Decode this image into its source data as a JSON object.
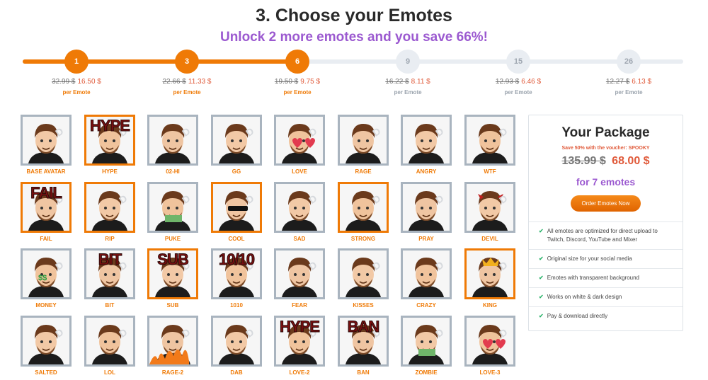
{
  "header": {
    "title": "3. Choose your Emotes",
    "subtitle": "Unlock 2 more emotes and you save 66%!"
  },
  "steps": [
    {
      "count": "1",
      "old_price": "32.99 $",
      "new_price": "16.50 $",
      "per": "per Emote",
      "active": true
    },
    {
      "count": "3",
      "old_price": "22.66 $",
      "new_price": "11.33 $",
      "per": "per Emote",
      "active": true
    },
    {
      "count": "6",
      "old_price": "19.50 $",
      "new_price": "9.75 $",
      "per": "per Emote",
      "active": true
    },
    {
      "count": "9",
      "old_price": "16.22 $",
      "new_price": "8.11 $",
      "per": "per Emote",
      "active": false
    },
    {
      "count": "15",
      "old_price": "12.93 $",
      "new_price": "6.46 $",
      "per": "per Emote",
      "active": false
    },
    {
      "count": "26",
      "old_price": "12.27 $",
      "new_price": "6.13 $",
      "per": "per Emote",
      "active": false
    }
  ],
  "emotes": [
    {
      "label": "BASE AVATAR",
      "selected": false,
      "overlay": ""
    },
    {
      "label": "HYPE",
      "selected": true,
      "overlay": "HYPE"
    },
    {
      "label": "02-HI",
      "selected": false,
      "overlay": ""
    },
    {
      "label": "GG",
      "selected": false,
      "overlay": ""
    },
    {
      "label": "LOVE",
      "selected": false,
      "overlay": ""
    },
    {
      "label": "RAGE",
      "selected": false,
      "overlay": ""
    },
    {
      "label": "ANGRY",
      "selected": false,
      "overlay": ""
    },
    {
      "label": "WTF",
      "selected": false,
      "overlay": ""
    },
    {
      "label": "FAIL",
      "selected": true,
      "overlay": "FAIL"
    },
    {
      "label": "RIP",
      "selected": true,
      "overlay": ""
    },
    {
      "label": "PUKE",
      "selected": false,
      "overlay": ""
    },
    {
      "label": "COOL",
      "selected": true,
      "overlay": ""
    },
    {
      "label": "SAD",
      "selected": false,
      "overlay": ""
    },
    {
      "label": "STRONG",
      "selected": true,
      "overlay": ""
    },
    {
      "label": "PRAY",
      "selected": false,
      "overlay": ""
    },
    {
      "label": "DEVIL",
      "selected": false,
      "overlay": ""
    },
    {
      "label": "MONEY",
      "selected": false,
      "overlay": ""
    },
    {
      "label": "BIT",
      "selected": false,
      "overlay": "BIT"
    },
    {
      "label": "SUB",
      "selected": true,
      "overlay": "SUB"
    },
    {
      "label": "1010",
      "selected": false,
      "overlay": "10/10"
    },
    {
      "label": "FEAR",
      "selected": false,
      "overlay": ""
    },
    {
      "label": "KISSES",
      "selected": false,
      "overlay": ""
    },
    {
      "label": "CRAZY",
      "selected": false,
      "overlay": ""
    },
    {
      "label": "KING",
      "selected": true,
      "overlay": ""
    },
    {
      "label": "SALTED",
      "selected": false,
      "overlay": ""
    },
    {
      "label": "LOL",
      "selected": false,
      "overlay": ""
    },
    {
      "label": "RAGE-2",
      "selected": false,
      "overlay": ""
    },
    {
      "label": "DAB",
      "selected": false,
      "overlay": ""
    },
    {
      "label": "LOVE-2",
      "selected": false,
      "overlay": "HYPE"
    },
    {
      "label": "BAN",
      "selected": false,
      "overlay": "BAN"
    },
    {
      "label": "ZOMBIE",
      "selected": false,
      "overlay": ""
    },
    {
      "label": "LOVE-3",
      "selected": false,
      "overlay": ""
    }
  ],
  "package": {
    "title": "Your Package",
    "voucher": "Save 50% with the voucher: SPOOKY",
    "old_price": "135.99 $",
    "new_price": "68.00 $",
    "count": "for 7 emotes",
    "order_label": "Order Emotes Now",
    "features": [
      "All emotes are optimized for direct upload to Twitch, Discord, YouTube and Mixer",
      "Original size for your social media",
      "Emotes with transparent background",
      "Works on white & dark design",
      "Pay & download directly"
    ]
  },
  "colors": {
    "accent": "#ef7a06",
    "purple": "#9b59d0",
    "price_red": "#e05a3a",
    "check_green": "#2bb36b"
  }
}
